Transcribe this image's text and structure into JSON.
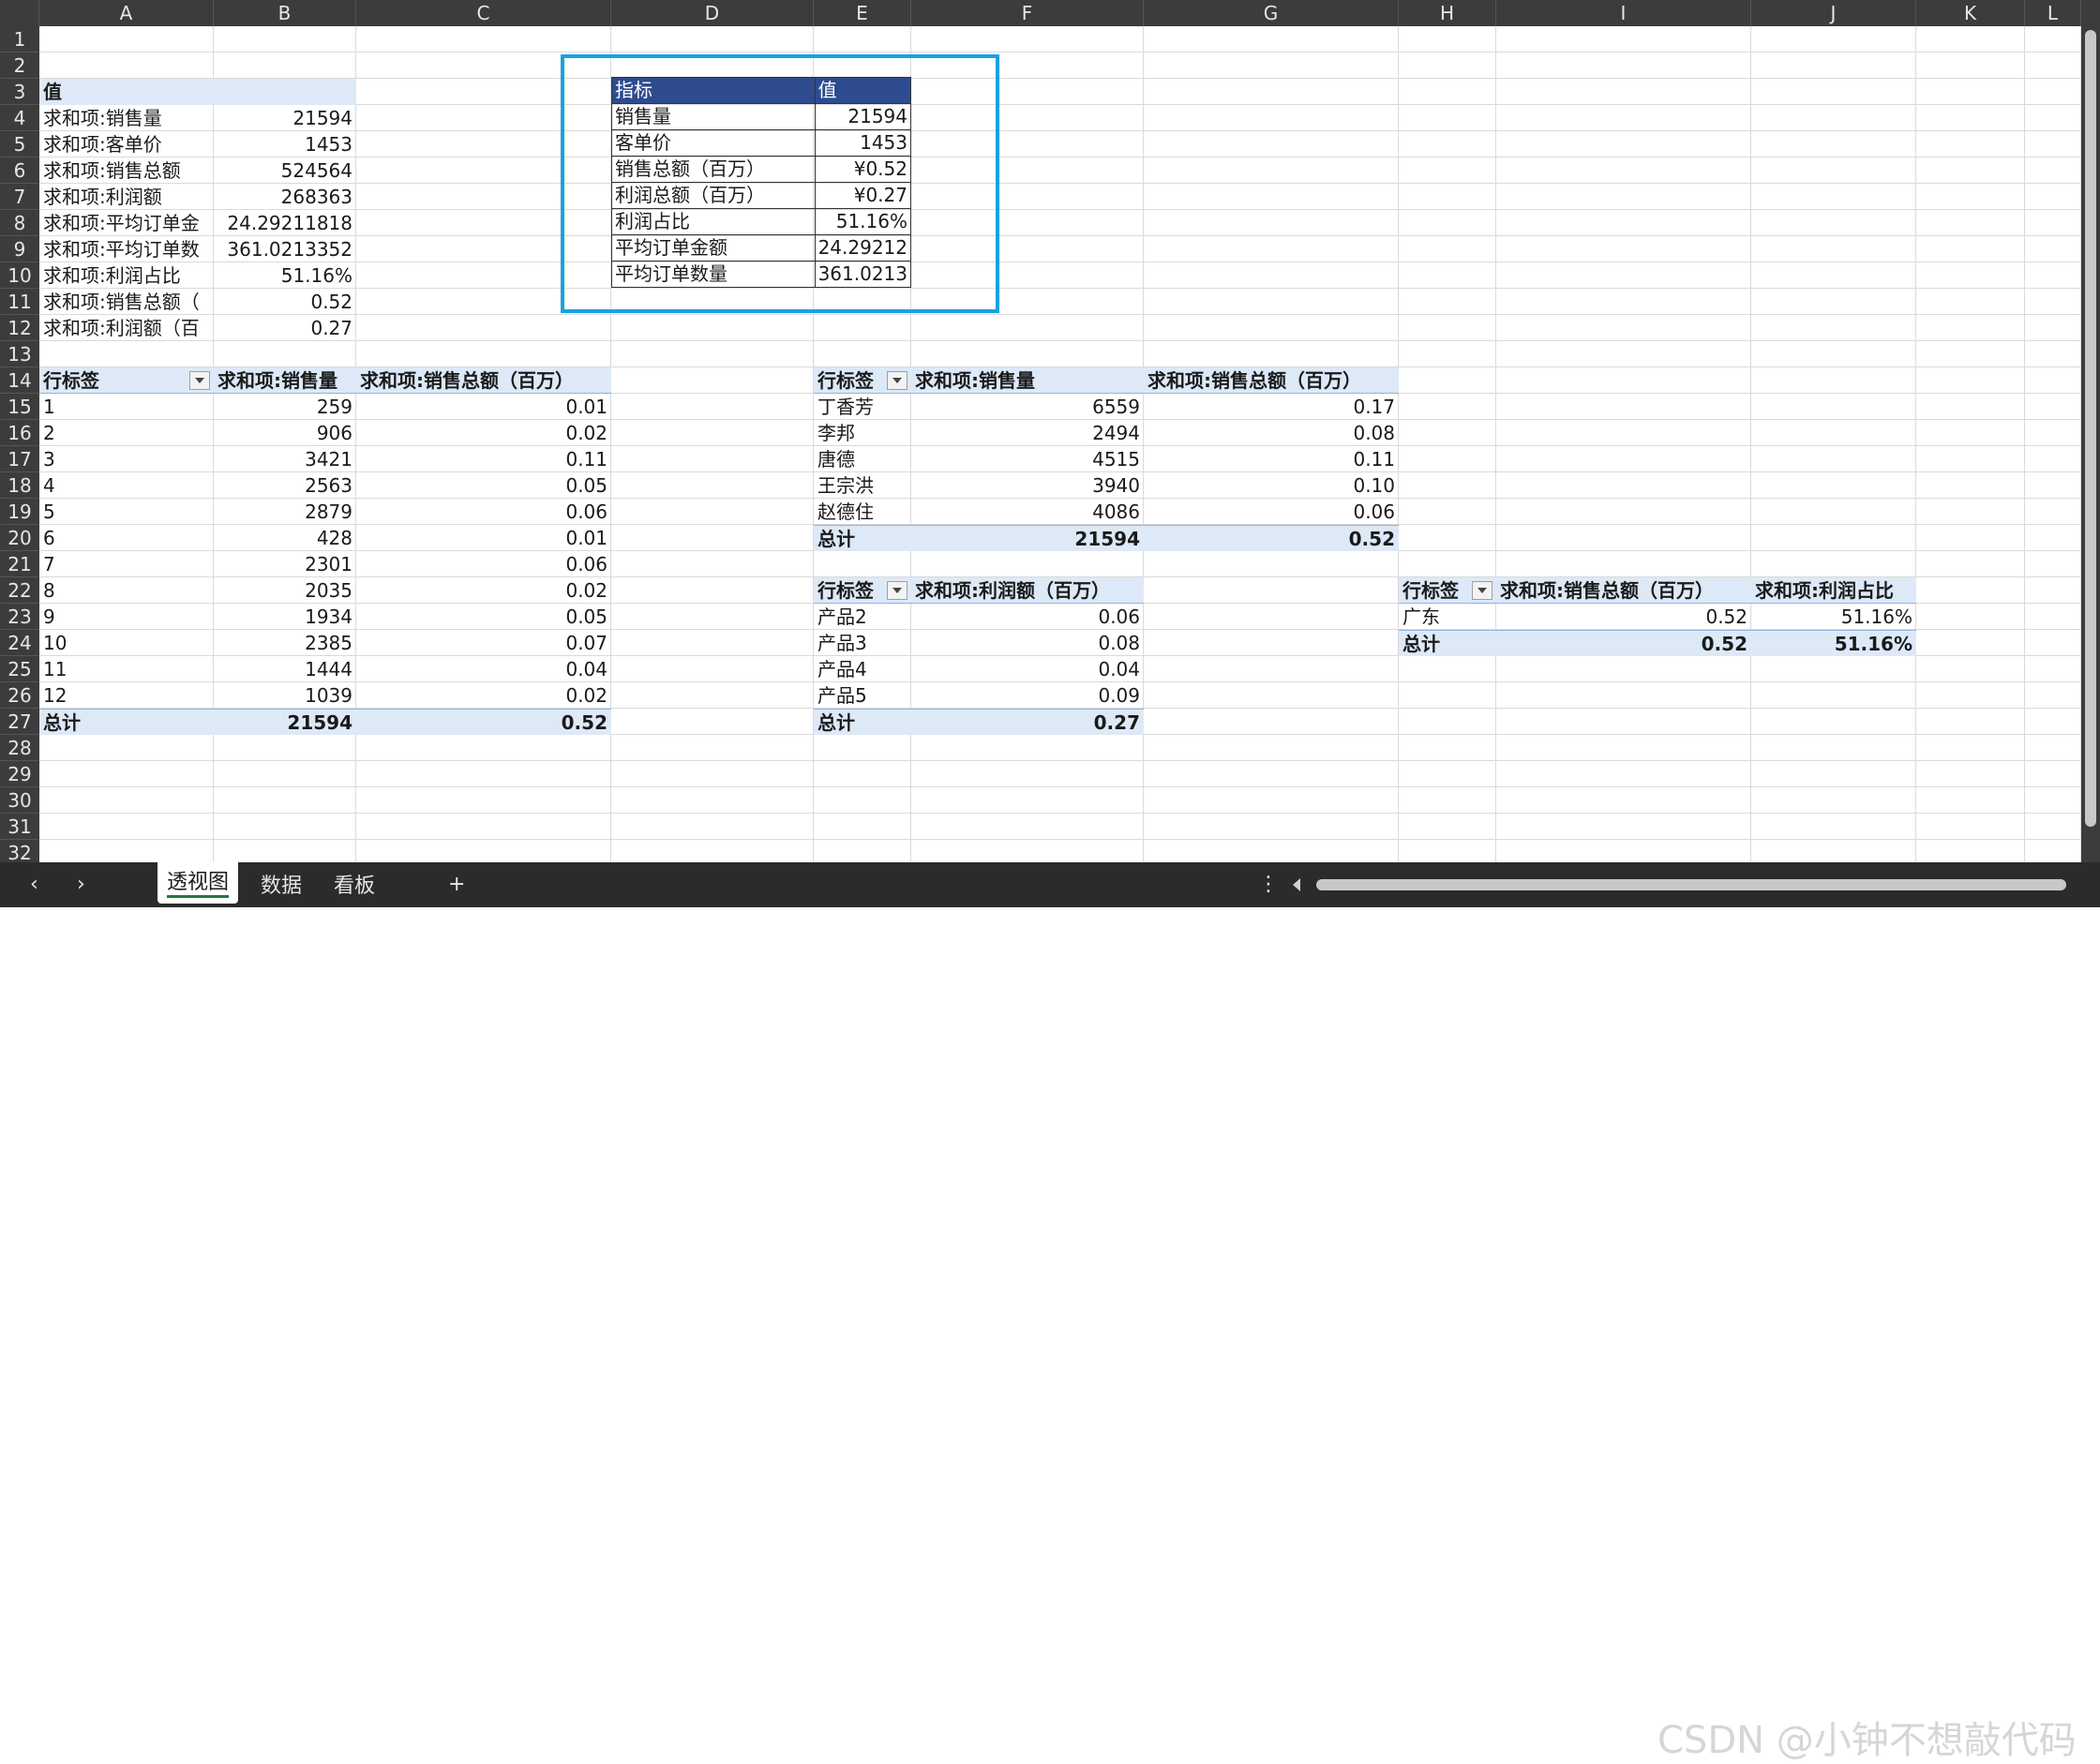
{
  "columns": [
    "A",
    "B",
    "C",
    "D",
    "E",
    "F",
    "G",
    "H",
    "I",
    "J",
    "K",
    "L"
  ],
  "rows": [
    "1",
    "2",
    "3",
    "4",
    "5",
    "6",
    "7",
    "8",
    "9",
    "10",
    "11",
    "12",
    "13",
    "14",
    "15",
    "16",
    "17",
    "18",
    "19",
    "20",
    "21",
    "22",
    "23",
    "24",
    "25",
    "26",
    "27",
    "28",
    "29",
    "30",
    "31",
    "32"
  ],
  "pivot_values": {
    "header": "值",
    "items": [
      {
        "label": "求和项:销售量",
        "value": "21594"
      },
      {
        "label": "求和项:客单价",
        "value": "1453"
      },
      {
        "label": "求和项:销售总额",
        "value": "524564"
      },
      {
        "label": "求和项:利润额",
        "value": "268363"
      },
      {
        "label": "求和项:平均订单金",
        "value": "24.29211818"
      },
      {
        "label": "求和项:平均订单数",
        "value": "361.0213352"
      },
      {
        "label": "求和项:利润占比",
        "value": "51.16%"
      },
      {
        "label": "求和项:销售总额（",
        "value": "0.52"
      },
      {
        "label": "求和项:利润额（百",
        "value": "0.27"
      }
    ]
  },
  "kpi_table": {
    "header": [
      "指标",
      "值"
    ],
    "rows": [
      {
        "label": "销售量",
        "value": "21594"
      },
      {
        "label": "客单价",
        "value": "1453"
      },
      {
        "label": "销售总额（百万）",
        "value": "¥0.52"
      },
      {
        "label": "利润总额（百万）",
        "value": "¥0.27"
      },
      {
        "label": "利润占比",
        "value": "51.16%"
      },
      {
        "label": "平均订单金额",
        "value": "24.29212"
      },
      {
        "label": "平均订单数量",
        "value": "361.0213"
      }
    ]
  },
  "pivot_month": {
    "headers": [
      "行标签",
      "求和项:销售量",
      "求和项:销售总额（百万）"
    ],
    "rows": [
      [
        "1",
        "259",
        "0.01"
      ],
      [
        "2",
        "906",
        "0.02"
      ],
      [
        "3",
        "3421",
        "0.11"
      ],
      [
        "4",
        "2563",
        "0.05"
      ],
      [
        "5",
        "2879",
        "0.06"
      ],
      [
        "6",
        "428",
        "0.01"
      ],
      [
        "7",
        "2301",
        "0.06"
      ],
      [
        "8",
        "2035",
        "0.02"
      ],
      [
        "9",
        "1934",
        "0.05"
      ],
      [
        "10",
        "2385",
        "0.07"
      ],
      [
        "11",
        "1444",
        "0.04"
      ],
      [
        "12",
        "1039",
        "0.02"
      ]
    ],
    "total": [
      "总计",
      "21594",
      "0.52"
    ]
  },
  "pivot_person": {
    "headers": [
      "行标签",
      "求和项:销售量",
      "求和项:销售总额（百万）"
    ],
    "rows": [
      [
        "丁香芳",
        "6559",
        "0.17"
      ],
      [
        "李邦",
        "2494",
        "0.08"
      ],
      [
        "唐德",
        "4515",
        "0.11"
      ],
      [
        "王宗洪",
        "3940",
        "0.10"
      ],
      [
        "赵德住",
        "4086",
        "0.06"
      ]
    ],
    "total": [
      "总计",
      "21594",
      "0.52"
    ]
  },
  "pivot_product": {
    "headers": [
      "行标签",
      "求和项:利润额（百万）"
    ],
    "rows": [
      [
        "产品2",
        "0.06"
      ],
      [
        "产品3",
        "0.08"
      ],
      [
        "产品4",
        "0.04"
      ],
      [
        "产品5",
        "0.09"
      ]
    ],
    "total": [
      "总计",
      "0.27"
    ]
  },
  "pivot_region": {
    "headers": [
      "行标签",
      "求和项:销售总额（百万）",
      "求和项:利润占比"
    ],
    "rows": [
      [
        "广东",
        "0.52",
        "51.16%"
      ]
    ],
    "total": [
      "总计",
      "0.52",
      "51.16%"
    ]
  },
  "sheet_tabs": [
    "透视图",
    "数据",
    "看板"
  ],
  "tabbar": {
    "prev": "‹",
    "next": "›",
    "add": "+",
    "more": "⋮"
  },
  "watermark": "CSDN @小钟不想敲代码",
  "colors": {
    "accent_box": "#1aa1e2",
    "kpi_header": "#2e4b8f",
    "pivot_highlight": "#dde9f7"
  }
}
